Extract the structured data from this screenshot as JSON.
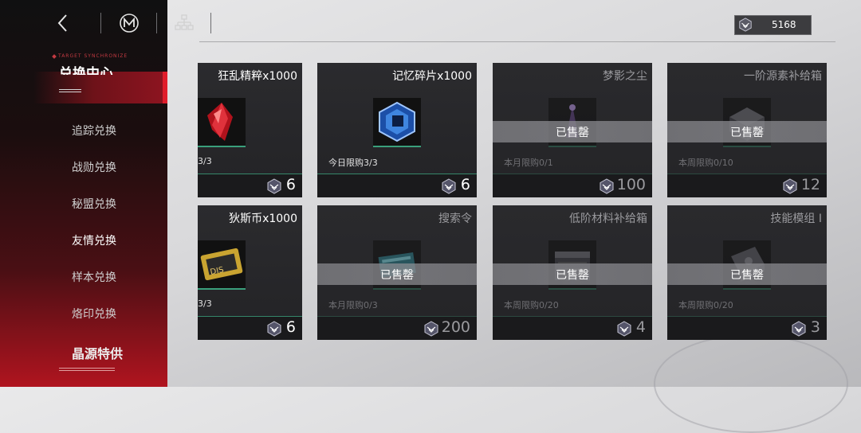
{
  "top": {
    "currency_value": "5168"
  },
  "sidebar": {
    "active_label": "兑换中心",
    "items": [
      {
        "label": "追踪兑换"
      },
      {
        "label": "战勋兑换"
      },
      {
        "label": "秘盟兑换"
      },
      {
        "label": "友情兑换"
      },
      {
        "label": "样本兑换"
      },
      {
        "label": "烙印兑换"
      }
    ],
    "special_label": "晶源特供"
  },
  "cards": [
    {
      "name": "狂乱精粹x1000",
      "limit": "3/3",
      "price": "6",
      "sold": false,
      "art": "crimson-crystal"
    },
    {
      "name": "记忆碎片x1000",
      "limit": "今日限购3/3",
      "price": "6",
      "sold": false,
      "art": "blue-fragment"
    },
    {
      "name": "梦影之尘",
      "limit": "本月限购0/1",
      "price": "100",
      "sold": true,
      "sold_label": "已售罄",
      "art": "purple-dust"
    },
    {
      "name": "一阶源素补给箱",
      "limit": "本周限购0/10",
      "price": "12",
      "sold": true,
      "sold_label": "已售罄",
      "art": "supply-box"
    },
    {
      "name": "狄斯币x1000",
      "limit": "3/3",
      "price": "6",
      "sold": false,
      "art": "dis-coin"
    },
    {
      "name": "搜索令",
      "limit": "本月限购0/3",
      "price": "200",
      "sold": true,
      "sold_label": "已售罄",
      "art": "search-order"
    },
    {
      "name": "低阶材料补给箱",
      "limit": "本周限购0/20",
      "price": "4",
      "sold": true,
      "sold_label": "已售罄",
      "art": "material-box"
    },
    {
      "name": "技能模组 I",
      "limit": "本周限购0/20",
      "price": "3",
      "sold": true,
      "sold_label": "已售罄",
      "art": "skill-module"
    }
  ],
  "colors": {
    "accent": "#e01d2b",
    "sidebar_dark": "#101011",
    "sidebar_red": "#b0141f",
    "card": "#2b2b2e",
    "line": "#3aa07c"
  }
}
